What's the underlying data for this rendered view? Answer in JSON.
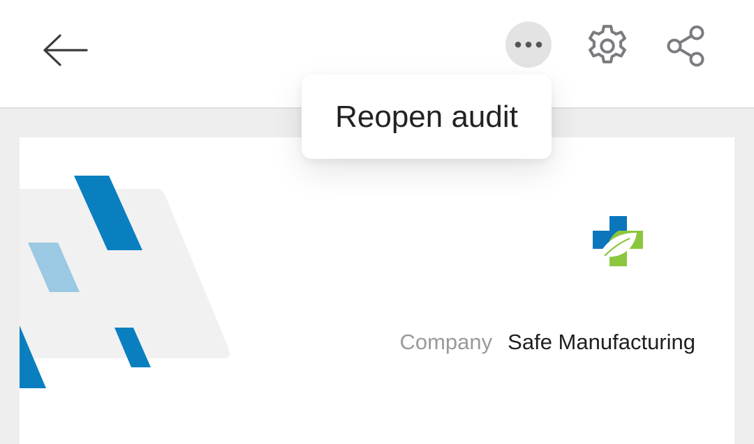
{
  "header": {
    "back_icon": "arrow-left-icon",
    "more_icon": "more-horizontal-icon",
    "settings_icon": "gear-icon",
    "share_icon": "share-icon"
  },
  "popup_menu": {
    "items": [
      {
        "label": "Reopen audit"
      }
    ]
  },
  "card": {
    "logo_icon": "medical-cross-leaf-logo",
    "company_label": "Company",
    "company_value": "Safe Manufacturing"
  },
  "colors": {
    "accent_blue": "#0a7fc0",
    "light_blue": "#9bc8e2",
    "logo_green": "#8cc63f",
    "logo_blue": "#0b76bc",
    "icon_gray": "#7b7b80"
  }
}
